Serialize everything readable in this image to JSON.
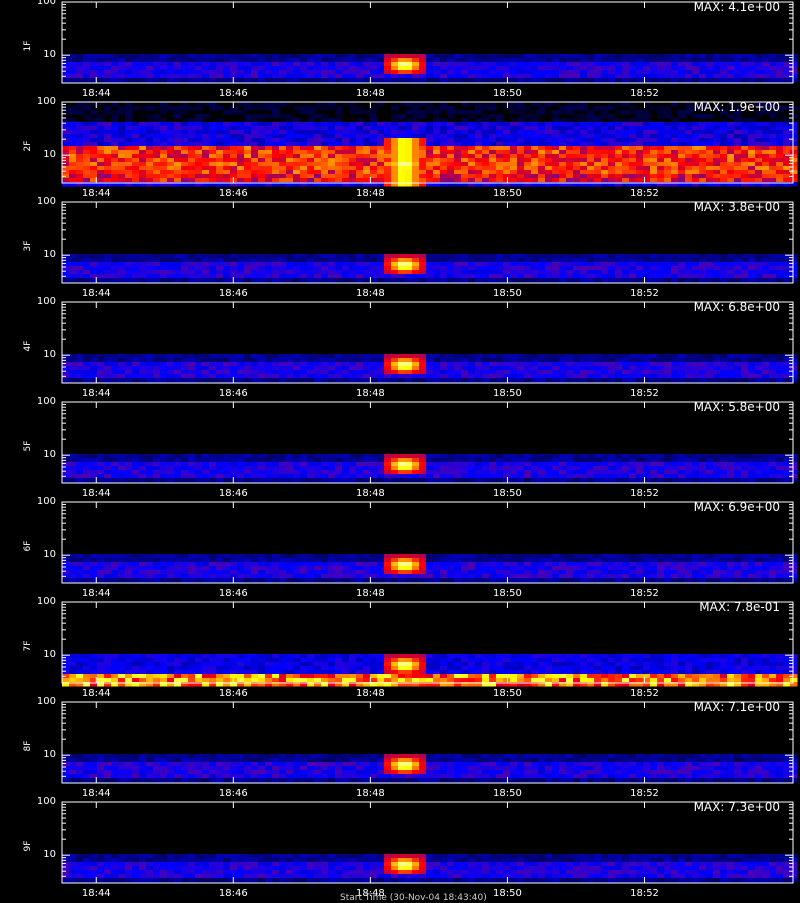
{
  "chart_data": {
    "type": "heatmap",
    "y_scale": "log",
    "ylim": [
      3,
      100
    ],
    "y_ticks": [
      "10",
      "100"
    ],
    "x_ticks": [
      "18:44",
      "18:46",
      "18:48",
      "18:50",
      "18:52"
    ],
    "x_range": [
      "18:43:30",
      "18:54:10"
    ],
    "burst_time": "18:48:30",
    "colormap": [
      "#000000",
      "#0000ff",
      "#ff0000",
      "#ffff00",
      "#ffffff"
    ],
    "panels": [
      {
        "name": "1F",
        "max_label": "MAX: 4.1e+00",
        "background": "low"
      },
      {
        "name": "2F",
        "max_label": "MAX: 1.9e+00",
        "background": "high"
      },
      {
        "name": "3F",
        "max_label": "MAX: 3.8e+00",
        "background": "low"
      },
      {
        "name": "4F",
        "max_label": "MAX: 6.8e+00",
        "background": "low"
      },
      {
        "name": "5F",
        "max_label": "MAX: 5.8e+00",
        "background": "low"
      },
      {
        "name": "6F",
        "max_label": "MAX: 6.9e+00",
        "background": "low"
      },
      {
        "name": "7F",
        "max_label": "MAX: 7.8e-01",
        "background": "noisy-bottom"
      },
      {
        "name": "8F",
        "max_label": "MAX: 7.1e+00",
        "background": "low"
      },
      {
        "name": "9F",
        "max_label": "MAX: 7.3e+00",
        "background": "low"
      }
    ],
    "xlabel": "Start Time (30-Nov-04 18:43:40)"
  }
}
